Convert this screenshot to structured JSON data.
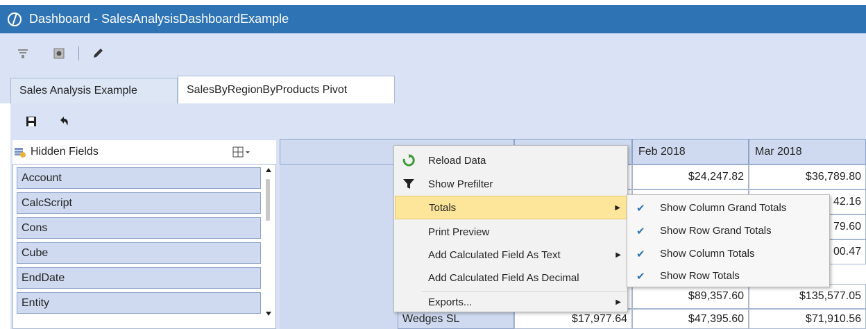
{
  "window": {
    "title": "Dashboard - SalesAnalysisDashboardExample"
  },
  "toolbar": {
    "icons": [
      "filter-icon",
      "settings-icon",
      "pencil-icon"
    ]
  },
  "tabs": [
    {
      "label": "Sales Analysis Example",
      "active": false
    },
    {
      "label": "SalesByRegionByProducts Pivot",
      "active": true
    }
  ],
  "subtoolbar": {
    "icons": [
      "save-icon",
      "undo-icon"
    ]
  },
  "hidden_fields": {
    "title": "Hidden Fields",
    "items": [
      "Account",
      "CalcScript",
      "Cons",
      "Cube",
      "EndDate",
      "Entity"
    ]
  },
  "pivot": {
    "columns": [
      "Feb 2018",
      "Mar 2018"
    ],
    "rows": [
      {
        "label": "",
        "feb": "$24,247.82",
        "mar": "$36,789.80"
      },
      {
        "label": "",
        "feb": "",
        "mar": "42.16"
      },
      {
        "label": "",
        "feb": "",
        "mar": "79.60"
      },
      {
        "label": "",
        "feb": "",
        "mar": "00.47"
      },
      {
        "label": "",
        "feb": "$89,357.60",
        "mar": "$135,577.05"
      },
      {
        "label": "Wedges SL",
        "jan": "$17,977.64",
        "feb": "$47,395.60",
        "mar": "$71,910.56"
      }
    ]
  },
  "context_menu": {
    "items": [
      {
        "label": "Reload Data",
        "icon": "reload-icon"
      },
      {
        "label": "Show Prefilter",
        "icon": "filter-icon"
      },
      {
        "label": "Totals",
        "submenu": true,
        "highlighted": true
      },
      {
        "label": "Print Preview"
      },
      {
        "label": "Add Calculated Field As Text",
        "submenu": true
      },
      {
        "label": "Add Calculated Field As Decimal"
      },
      {
        "label": "Exports...",
        "submenu": true
      }
    ]
  },
  "totals_submenu": {
    "items": [
      {
        "label": "Show Column Grand Totals",
        "checked": true
      },
      {
        "label": "Show Row Grand Totals",
        "checked": true
      },
      {
        "label": "Show Column Totals",
        "checked": true
      },
      {
        "label": "Show Row Totals",
        "checked": true
      }
    ]
  },
  "colors": {
    "titlebar": "#2e74b5",
    "toolbar": "#d9e3f5",
    "menu_highlight": "#fde69a",
    "check": "#2e74b5"
  }
}
